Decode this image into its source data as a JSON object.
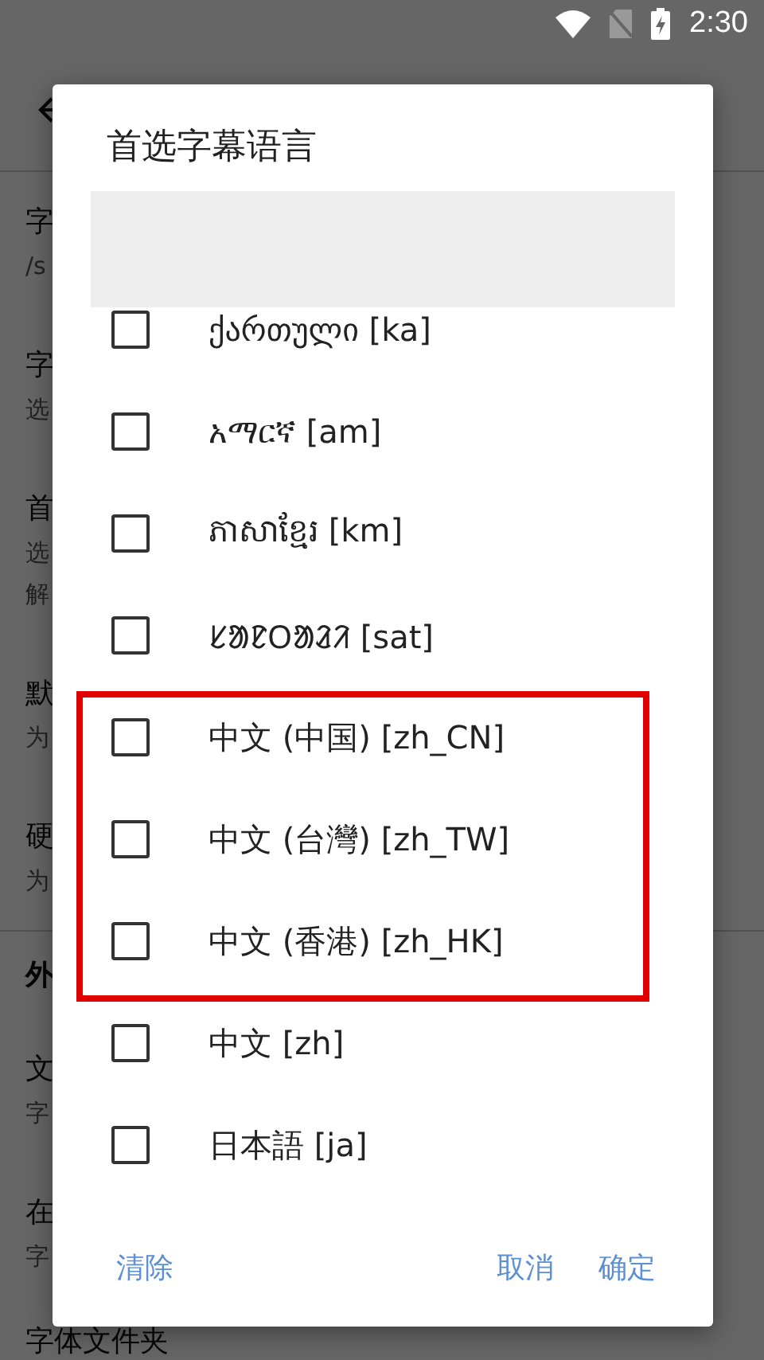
{
  "status_bar": {
    "time": "2:30"
  },
  "background": {
    "items": [
      {
        "kind": "row",
        "title": "字",
        "lines": [
          "/s"
        ]
      },
      {
        "kind": "row",
        "title": "字",
        "lines": [
          "选"
        ]
      },
      {
        "kind": "row",
        "title": "首",
        "lines": [
          "选",
          "解"
        ]
      },
      {
        "kind": "row",
        "title": "默",
        "lines": [
          "为"
        ]
      },
      {
        "kind": "row",
        "title": "硬",
        "lines": [
          "为"
        ]
      },
      {
        "kind": "section",
        "title": "外"
      },
      {
        "kind": "row",
        "title": "文",
        "lines": [
          "字"
        ]
      },
      {
        "kind": "row",
        "title": "在",
        "lines": [
          "字"
        ]
      },
      {
        "kind": "row",
        "title": "字体文件夹"
      }
    ]
  },
  "dialog": {
    "title": "首选字幕语言",
    "options": [
      {
        "label": "ქართული [ka]",
        "checked": false
      },
      {
        "label": "አማርኛ [am]",
        "checked": false
      },
      {
        "label": "ភាសាខ្មែរ [km]",
        "checked": false
      },
      {
        "label": "ᱥᱟᱱᱛᱟᱲᱤ [sat]",
        "checked": false
      },
      {
        "label": "中文 (中国) [zh_CN]",
        "checked": false
      },
      {
        "label": "中文 (台灣) [zh_TW]",
        "checked": false
      },
      {
        "label": "中文 (香港) [zh_HK]",
        "checked": false
      },
      {
        "label": "中文 [zh]",
        "checked": false
      },
      {
        "label": "日本語 [ja]",
        "checked": false
      }
    ],
    "buttons": [
      {
        "label": "清除"
      },
      {
        "label": "取消"
      },
      {
        "label": "确定"
      }
    ]
  }
}
